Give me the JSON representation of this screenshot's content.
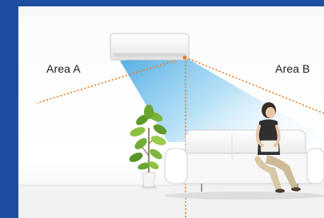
{
  "labels": {
    "area_a": "Area A",
    "area_b": "Area B"
  },
  "colors": {
    "frame_blue": "#1f4ea1",
    "airflow_blue": "#63bfee",
    "guide_line_orange": "#e77b24",
    "floor": "#f1f1f1",
    "wall_top": "#f8f8f8"
  },
  "icons": {
    "air_conditioner": "air-conditioner-unit-icon",
    "plant": "potted-plant-icon",
    "sofa": "sofa-icon",
    "person": "seated-person-icon"
  }
}
